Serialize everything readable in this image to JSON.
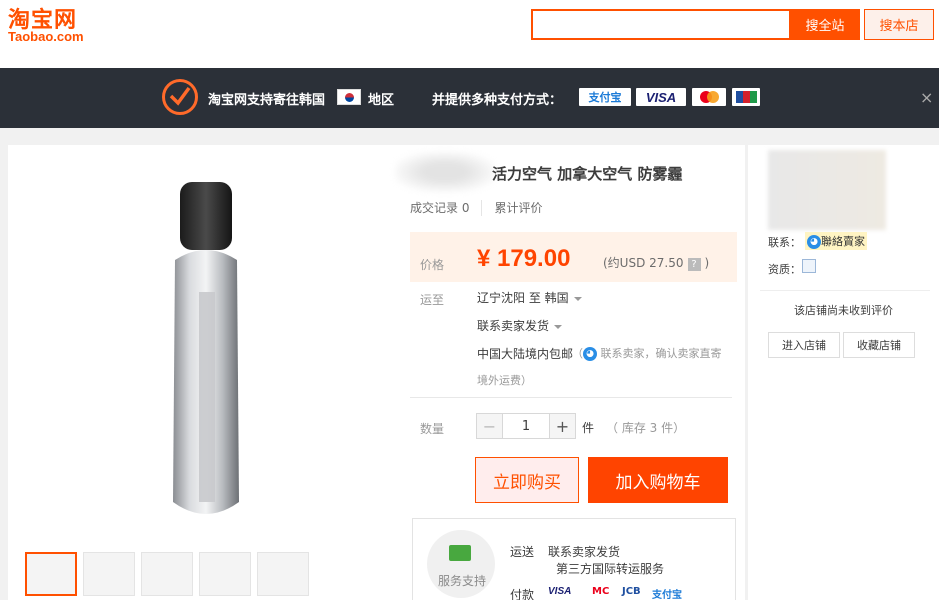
{
  "header": {
    "logo_cn": "淘宝网",
    "logo_en": "Taobao.com",
    "search_value": "",
    "search_all_label": "搜全站",
    "search_shop_label": "搜本店"
  },
  "banner": {
    "support_text": "淘宝网支持寄往韩国",
    "region_text": "地区",
    "payment_text": "并提供多种支付方式：",
    "payments": [
      "支付宝",
      "VISA",
      "MasterCard",
      "JCB"
    ],
    "close_glyph": "×"
  },
  "product": {
    "title": "活力空气 加拿大空气 防雾霾",
    "sales_record": "成交记录 0",
    "reviews": "累计评价",
    "price_label": "价格",
    "price": "¥ 179.00",
    "usd_prefix": "(约USD 27.50",
    "usd_suffix": ")",
    "help_glyph": "?",
    "ship_to_label": "运至",
    "route": "辽宁沈阳 至  韩国",
    "seller_ship": "联系卖家发货",
    "free_ship": "中国大陆境内包邮",
    "contact_note": "联系卖家，确认卖家直寄",
    "contact_note_open": "（",
    "contact_note2": "境外运费）",
    "qty_label": "数量",
    "qty": "1",
    "minus": "−",
    "plus": "+",
    "unit": "件",
    "stock": "（ 库存 3 件）",
    "buy_now": "立即购买",
    "add_to_cart": "加入购物车",
    "thumb_count": 5
  },
  "service": {
    "label": "服务支持",
    "shipping_key": "运送",
    "shipping_value": "联系卖家发货",
    "shipping_value2": "第三方国际转运服务",
    "payment_key": "付款",
    "mini_payments": [
      "VISA",
      "MC",
      "JCB",
      "支付宝"
    ]
  },
  "side": {
    "contact_label": "联系：",
    "contact_link": "聯絡賣家",
    "qual_label": "资质：",
    "no_review": "该店铺尚未收到评价",
    "enter_shop": "进入店铺",
    "fav_shop": "收藏店铺"
  },
  "colors": {
    "brand": "#ff5000",
    "price": "#ff4400",
    "banner_bg": "#2b3038"
  },
  "icons": [
    "check-circle-icon",
    "korea-flag-icon",
    "close-icon",
    "help-icon",
    "wangwang-icon",
    "caret-down-icon",
    "service-icon",
    "qualification-icon"
  ]
}
